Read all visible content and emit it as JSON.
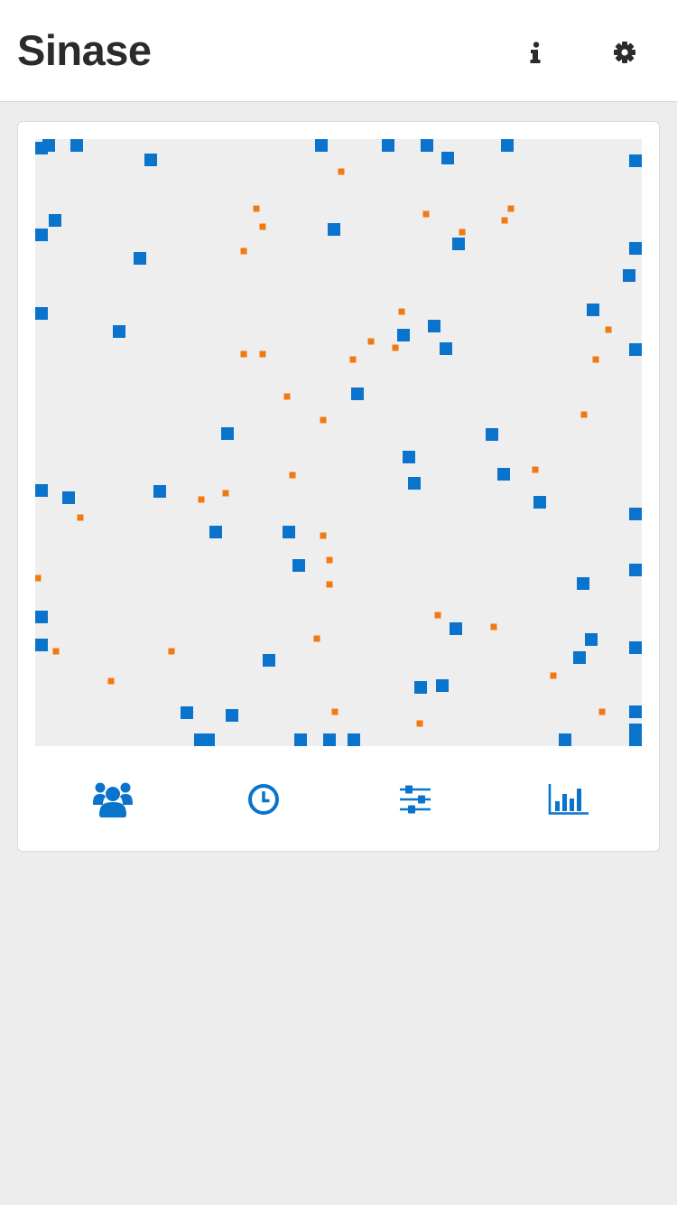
{
  "app": {
    "title": "Sinase"
  },
  "header": {
    "info_icon": "info-icon",
    "settings_icon": "gear-icon"
  },
  "colors": {
    "header_bg": "#ffffff",
    "page_bg": "#ededed",
    "sim_bg": "#eeeeee",
    "agent": "#0a74cc",
    "particle": "#f07a10",
    "toolbar_icon": "#0a74cc",
    "title": "#2b2b2b"
  },
  "toolbar": {
    "buttons": [
      {
        "icon": "people-icon"
      },
      {
        "icon": "clock-icon"
      },
      {
        "icon": "sliders-icon"
      },
      {
        "icon": "bar-chart-icon"
      }
    ]
  }
}
